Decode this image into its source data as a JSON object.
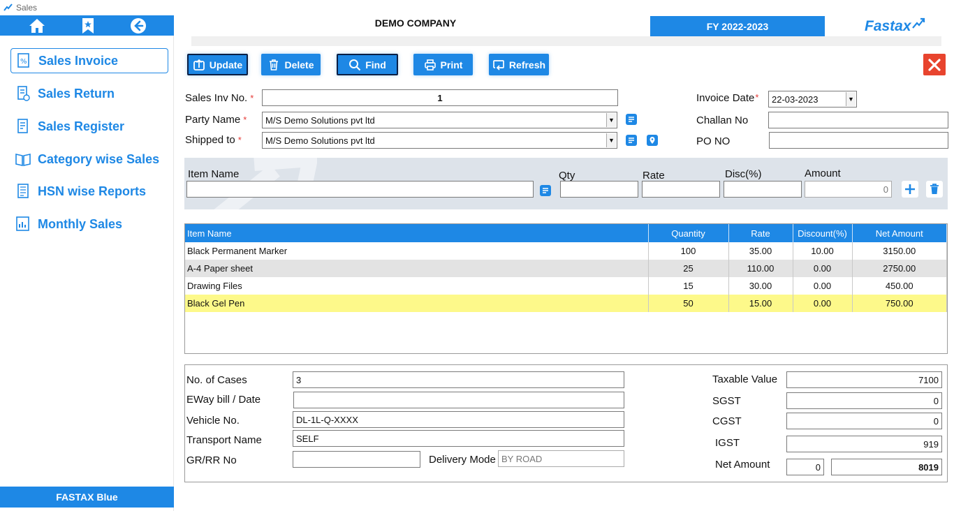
{
  "window": {
    "title": "Sales"
  },
  "sidebar": {
    "items": [
      {
        "label": "Sales Invoice",
        "icon": "invoice-icon",
        "active": true
      },
      {
        "label": "Sales Return",
        "icon": "return-icon",
        "active": false
      },
      {
        "label": "Sales Register",
        "icon": "register-icon",
        "active": false
      },
      {
        "label": "Category wise Sales",
        "icon": "book-icon",
        "active": false
      },
      {
        "label": "HSN wise Reports",
        "icon": "report-icon",
        "active": false
      },
      {
        "label": "Monthly Sales",
        "icon": "chart-icon",
        "active": false
      }
    ],
    "footer": "FASTAX Blue"
  },
  "header": {
    "company": "DEMO COMPANY",
    "fy": "FY 2022-2023",
    "brand": "Fastax"
  },
  "toolbar": {
    "update": "Update",
    "delete": "Delete",
    "find": "Find",
    "print": "Print",
    "refresh": "Refresh"
  },
  "form": {
    "sales_inv_no": {
      "label": "Sales Inv No.",
      "value": "1"
    },
    "party_name": {
      "label": "Party Name",
      "value": "M/S Demo Solutions pvt ltd"
    },
    "shipped_to": {
      "label": "Shipped to",
      "value": "M/S Demo Solutions pvt ltd"
    },
    "invoice_date": {
      "label": "Invoice Date",
      "value": "22-03-2023"
    },
    "challan_no": {
      "label": "Challan No",
      "value": ""
    },
    "po_no": {
      "label": "PO NO",
      "value": ""
    },
    "required_mark": "*"
  },
  "entry": {
    "item_name_label": "Item Name",
    "qty_label": "Qty",
    "rate_label": "Rate",
    "disc_label": "Disc(%)",
    "amount_label": "Amount",
    "amount_value": "0"
  },
  "grid": {
    "headers": [
      "Item Name",
      "Quantity",
      "Rate",
      "Discount(%)",
      "Net Amount"
    ],
    "rows": [
      [
        "Black Permanent Marker",
        "100",
        "35.00",
        "10.00",
        "3150.00"
      ],
      [
        "A-4 Paper sheet",
        "25",
        "110.00",
        "0.00",
        "2750.00"
      ],
      [
        "Drawing Files",
        "15",
        "30.00",
        "0.00",
        "450.00"
      ],
      [
        "Black Gel Pen",
        "50",
        "15.00",
        "0.00",
        "750.00"
      ]
    ]
  },
  "bottom": {
    "no_of_cases": {
      "label": "No. of Cases",
      "value": "3"
    },
    "eway_bill": {
      "label": "EWay bill / Date",
      "value": ""
    },
    "vehicle_no": {
      "label": "Vehicle No.",
      "value": "DL-1L-Q-XXXX"
    },
    "transport_name": {
      "label": "Transport Name",
      "value": "SELF"
    },
    "gr_rr_no": {
      "label": "GR/RR No",
      "value": ""
    },
    "delivery_mode": {
      "label": "Delivery Mode",
      "value": "BY ROAD"
    },
    "taxable_value": {
      "label": "Taxable Value",
      "value": "7100"
    },
    "sgst": {
      "label": "SGST",
      "value": "0"
    },
    "cgst": {
      "label": "CGST",
      "value": "0"
    },
    "igst": {
      "label": "IGST",
      "value": "919"
    },
    "net_amount": {
      "label": "Net Amount",
      "value1": "0",
      "value2": "8019"
    }
  },
  "colors": {
    "accent": "#1e88e5",
    "highlight_row": "#fdf98a",
    "close": "#e8442e"
  }
}
